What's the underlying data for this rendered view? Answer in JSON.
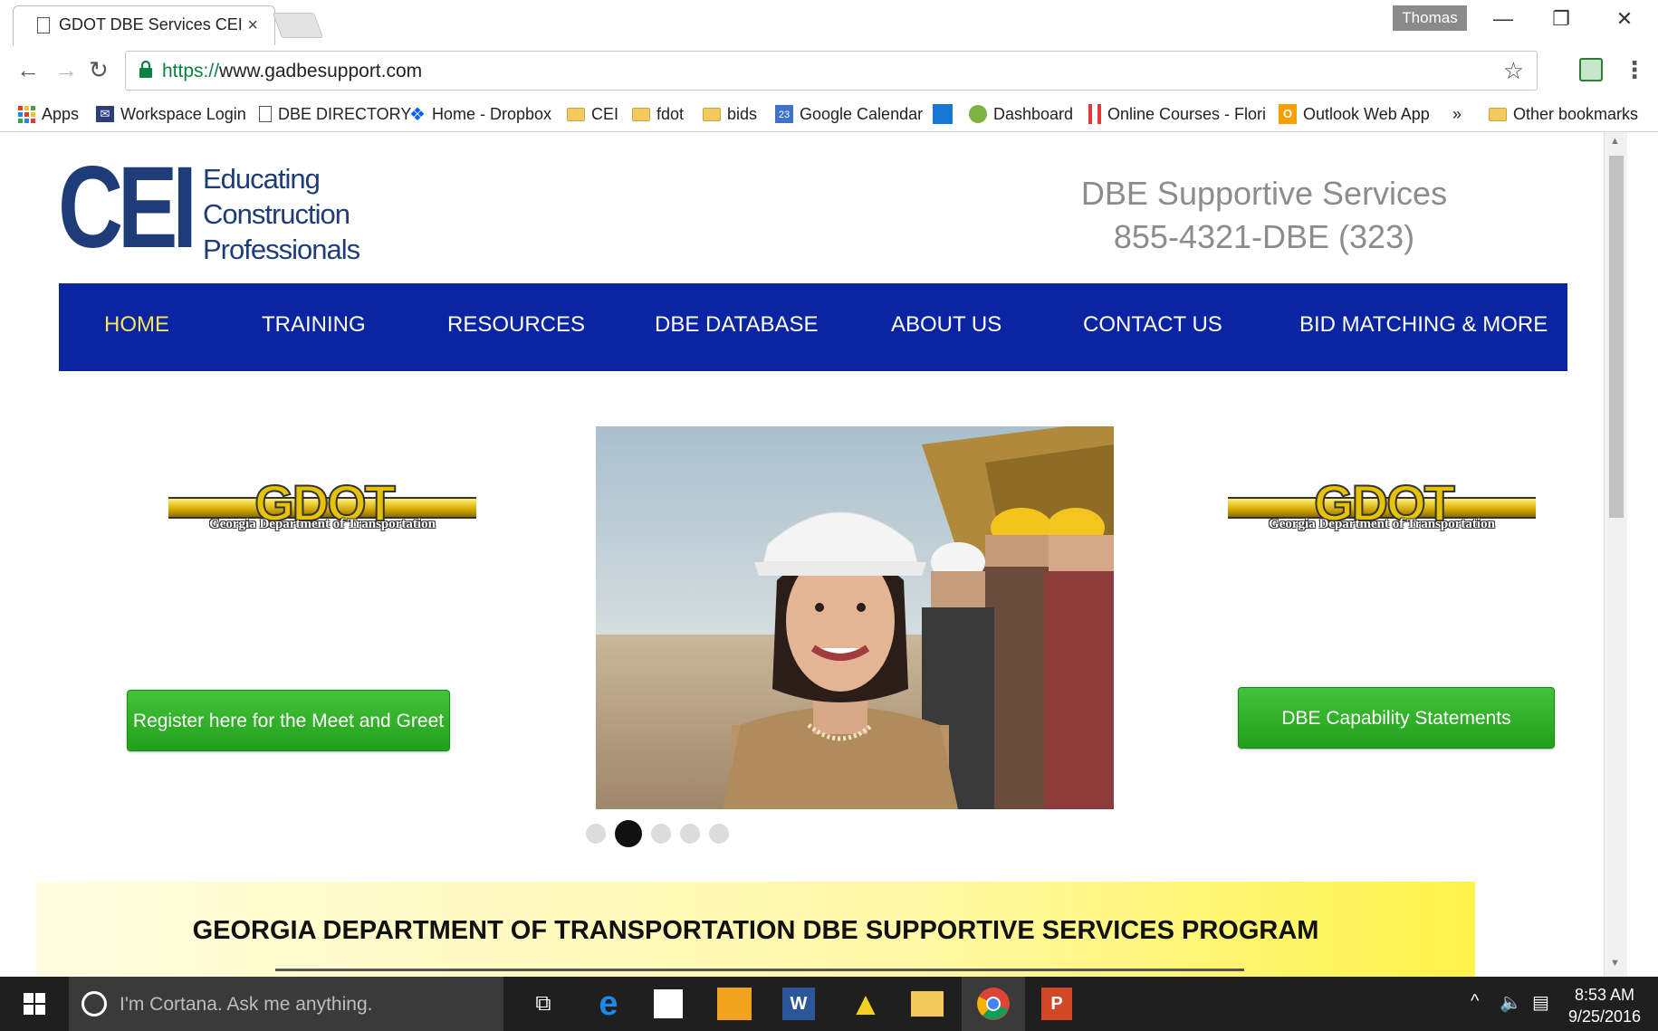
{
  "browser": {
    "tab_title": "GDOT DBE Services CEI",
    "tab_close": "×",
    "profile_name": "Thomas",
    "url_scheme": "https://",
    "url_host": "www.gadbesupport.com"
  },
  "bookmarks": {
    "items": [
      {
        "label": "Apps",
        "icon": "apps-grid-icon"
      },
      {
        "label": "Workspace Login",
        "icon": "mail-icon"
      },
      {
        "label": "DBE DIRECTORY",
        "icon": "page-icon"
      },
      {
        "label": "Home - Dropbox",
        "icon": "dropbox-icon"
      },
      {
        "label": "CEI",
        "icon": "folder-icon"
      },
      {
        "label": "fdot",
        "icon": "folder-icon"
      },
      {
        "label": "bids",
        "icon": "folder-icon"
      },
      {
        "label": "Google Calendar",
        "icon": "calendar-icon"
      },
      {
        "label": "",
        "icon": "blue-square-icon"
      },
      {
        "label": "Dashboard",
        "icon": "dashboard-icon"
      },
      {
        "label": "Online Courses - Flori",
        "icon": "courses-icon"
      },
      {
        "label": "Outlook Web App",
        "icon": "outlook-icon"
      }
    ],
    "overflow": "»",
    "other": "Other bookmarks"
  },
  "site": {
    "logo_text": "CEI",
    "logo_tagline": [
      "Educating",
      "Construction",
      "Professionals"
    ],
    "header_line1": "DBE Supportive Services",
    "header_line2": "855-4321-DBE (323)",
    "nav": [
      "HOME",
      "TRAINING",
      "RESOURCES",
      "DBE DATABASE",
      "ABOUT US",
      "CONTACT US",
      "BID MATCHING & MORE"
    ],
    "active_nav": "HOME",
    "gdot_logo_word": "GDOT",
    "gdot_logo_sub": "Georgia Department of Transportation",
    "left_button": "Register here for the Meet and Greet",
    "right_button": "DBE Capability Statements",
    "carousel_slides": 5,
    "carousel_active": 2,
    "banner_title": "GEORGIA DEPARTMENT OF TRANSPORTATION DBE SUPPORTIVE SERVICES PROGRAM"
  },
  "taskbar": {
    "search_placeholder": "I'm Cortana. Ask me anything.",
    "time": "8:53 AM",
    "date": "9/25/2016"
  },
  "colors": {
    "nav_bg": "#0a24a2",
    "nav_active": "#f4e65a",
    "logo_blue": "#1d3c78",
    "button_green": "#2aa822"
  }
}
